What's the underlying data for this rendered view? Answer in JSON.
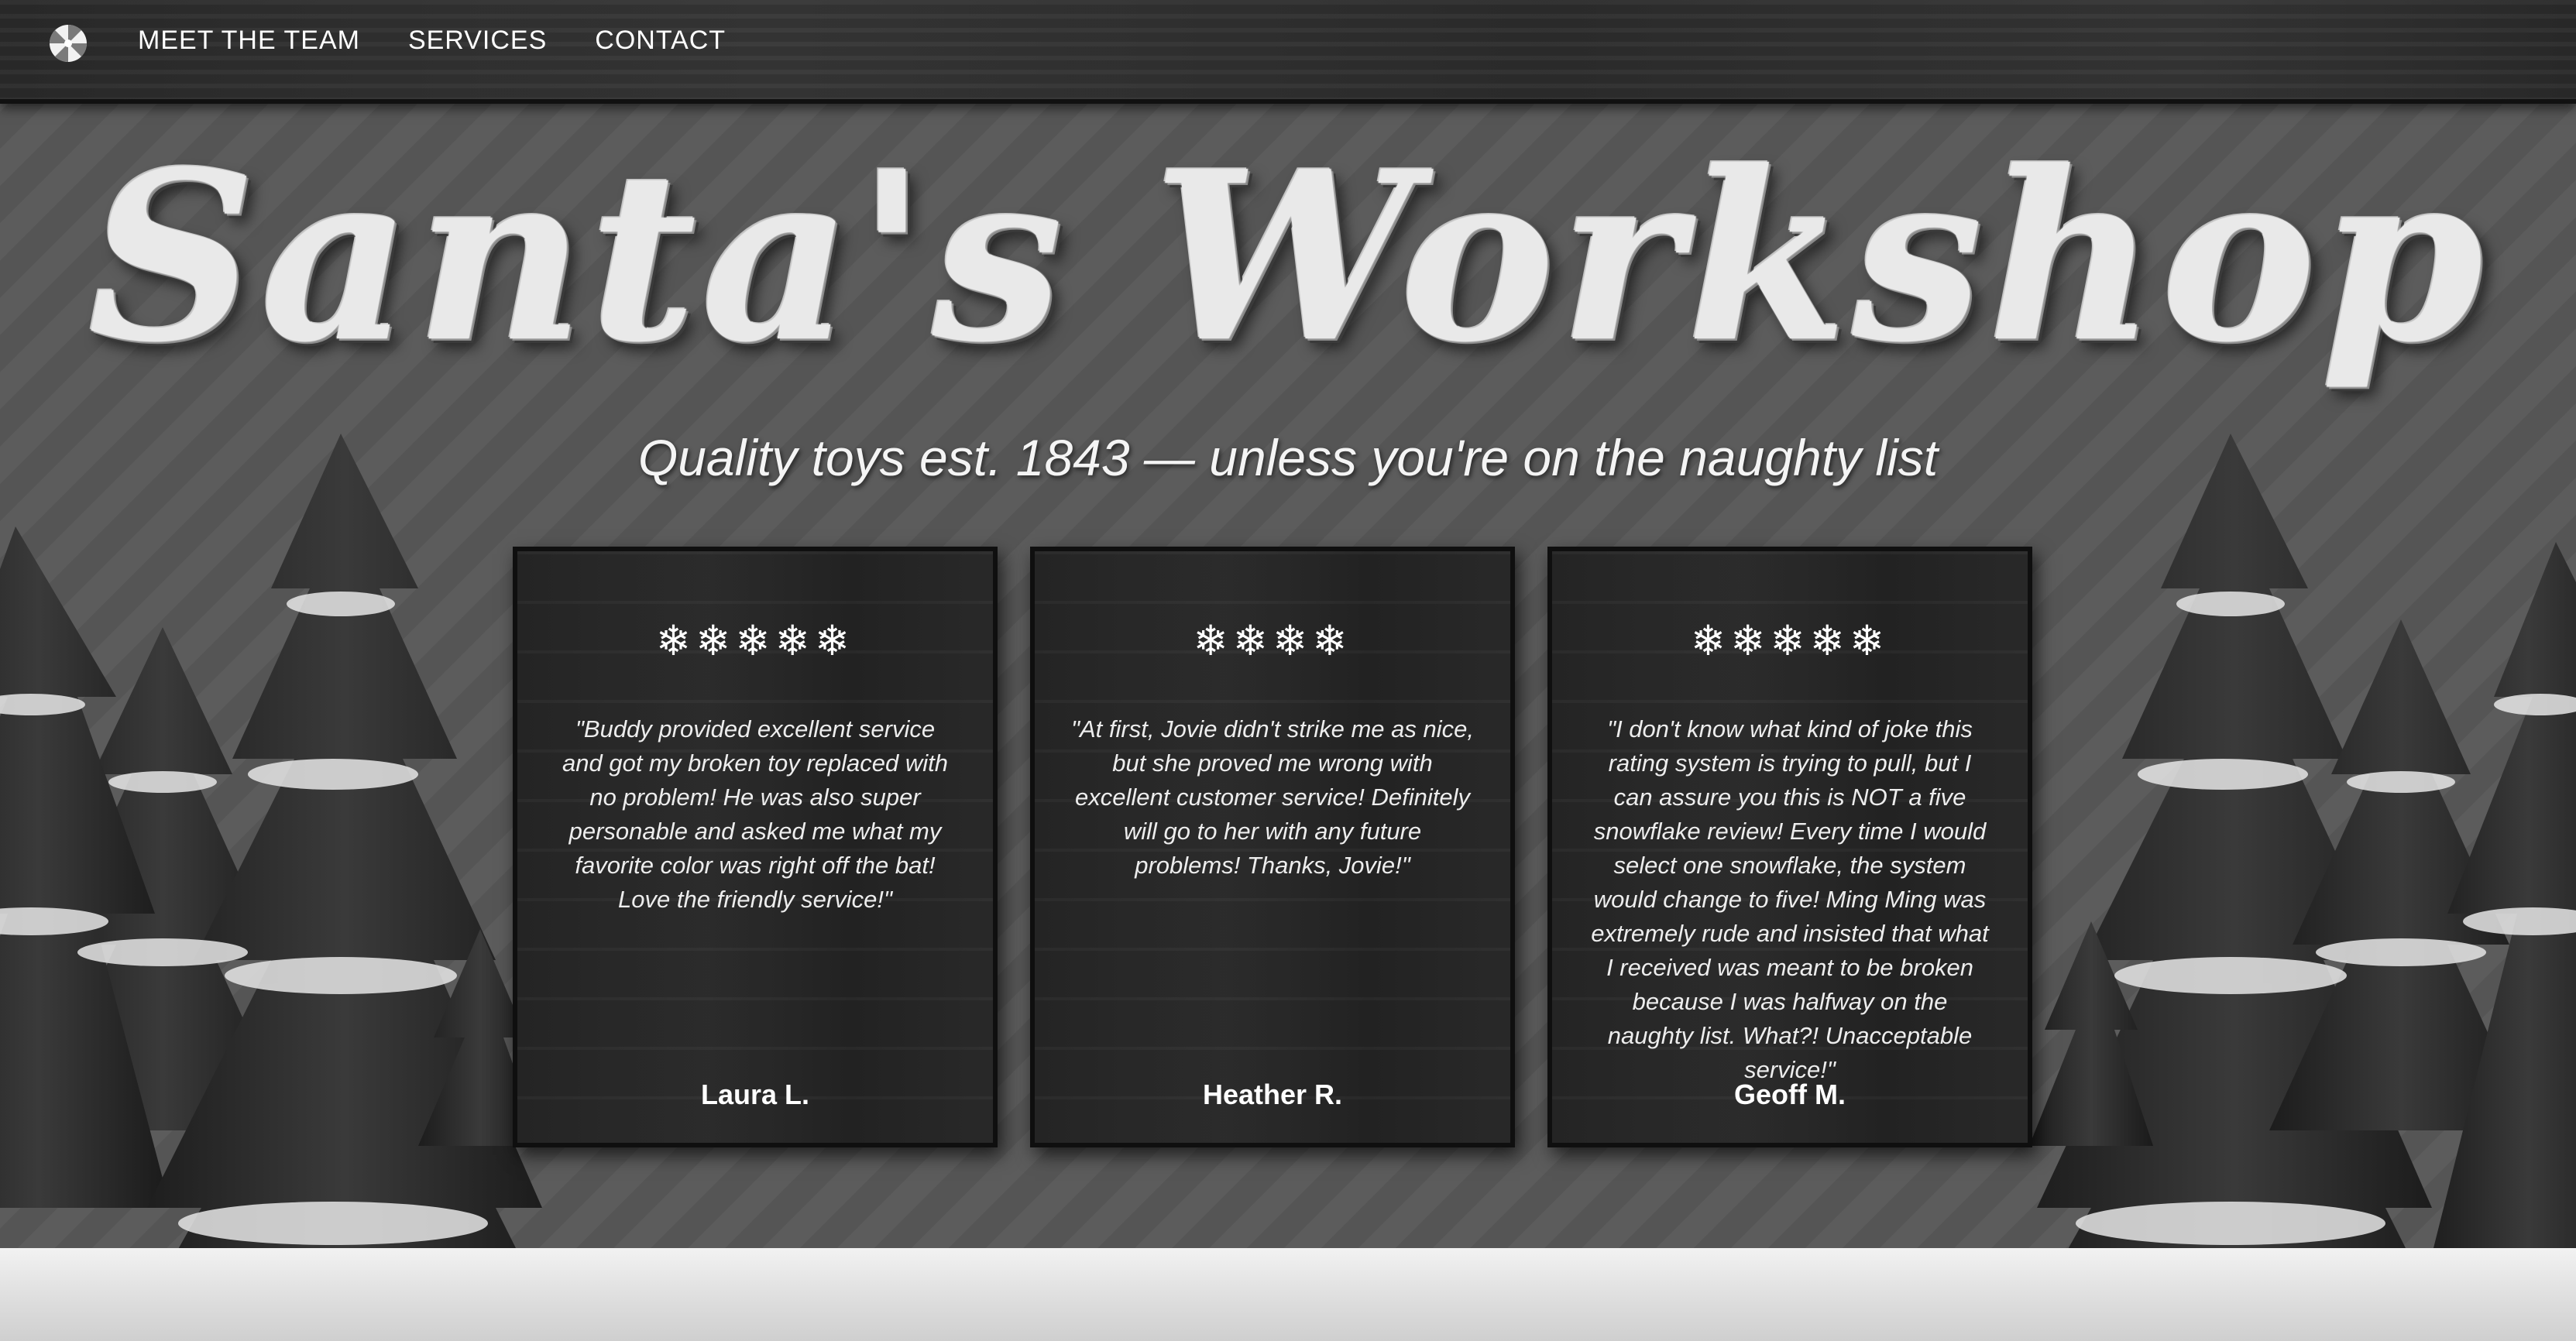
{
  "nav": {
    "logo_icon": "peppermint-candy-icon",
    "links": [
      {
        "label": "MEET THE TEAM"
      },
      {
        "label": "SERVICES"
      },
      {
        "label": "CONTACT"
      }
    ]
  },
  "hero": {
    "title": "Santa's Workshop",
    "subtitle": "Quality toys est. 1843 — unless you're on the naughty list"
  },
  "reviews": [
    {
      "rating": 5,
      "rating_display": "❄❄❄❄❄",
      "text": "\"Buddy provided excellent service and got my broken toy replaced with no problem! He was also super personable and asked me what my favorite color was right off the bat! Love the friendly service!\"",
      "author": "Laura L."
    },
    {
      "rating": 4,
      "rating_display": "❄❄❄❄",
      "text": "\"At first, Jovie didn't strike me as nice, but she proved me wrong with excellent customer service! Definitely will go to her with any future problems! Thanks, Jovie!\"",
      "author": "Heather R."
    },
    {
      "rating": 5,
      "rating_display": "❄❄❄❄❄",
      "text": "\"I don't know what kind of joke this rating system is trying to pull, but I can assure you this is NOT a five snowflake review! Every time I would select one snowflake, the system would change to five! Ming Ming was extremely rude and insisted that what I received was meant to be broken because I was halfway on the naughty list. What?! Unacceptable service!\"",
      "author": "Geoff M."
    }
  ],
  "colors": {
    "background": "#5c5c5c",
    "navbar": "#2f2f2f",
    "card": "#2a2a2a",
    "text": "#ffffff"
  }
}
